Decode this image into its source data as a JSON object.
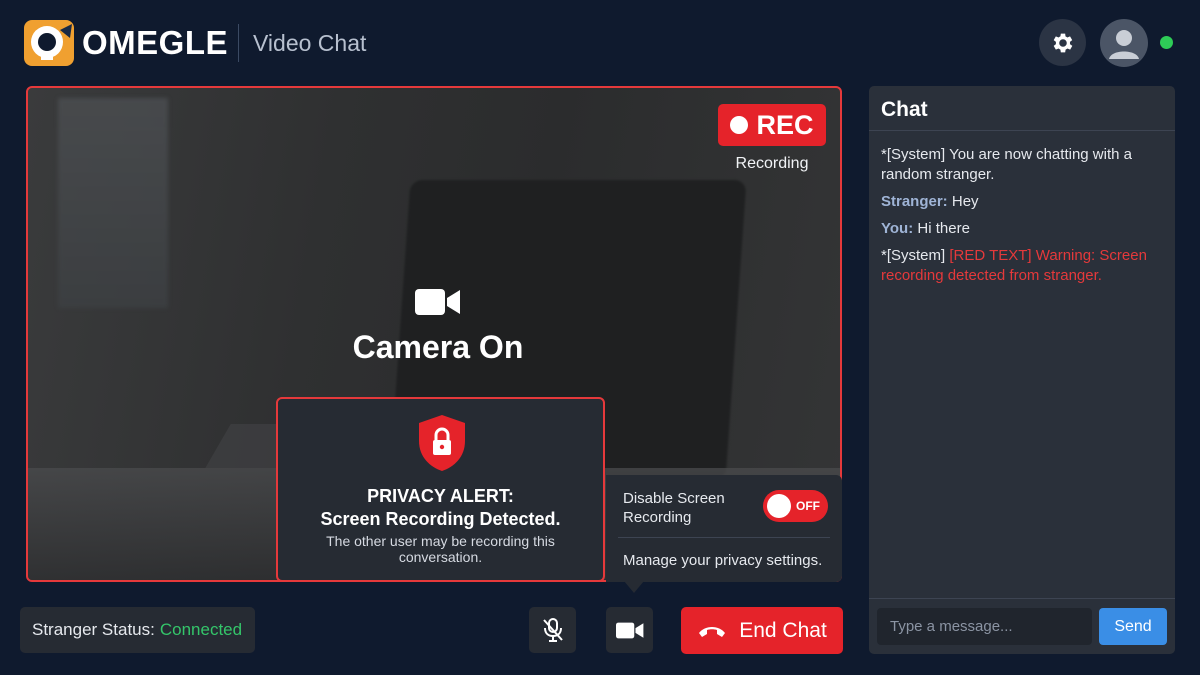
{
  "header": {
    "brand": "OMEGLE",
    "subtitle": "Video Chat",
    "icons": {
      "settings": "gear-icon",
      "avatar": "user-avatar-icon",
      "online": "online-status-dot"
    }
  },
  "video": {
    "rec_badge": "REC",
    "rec_caption": "Recording",
    "camera_label": "Camera On",
    "camera_icon": "video-camera-icon"
  },
  "alert": {
    "icon": "shield-lock-icon",
    "title_line1": "PRIVACY ALERT:",
    "title_line2": "Screen Recording Detected.",
    "body": "The other user may be recording this conversation."
  },
  "recording_settings": {
    "label": "Disable Screen Recording",
    "toggle_text": "OFF",
    "toggle_on": false,
    "manage_link": "Manage your privacy settings."
  },
  "status": {
    "label": "Stranger Status:",
    "value": "Connected"
  },
  "controls": {
    "mic_icon": "mic-off-icon",
    "video_icon": "video-camera-icon",
    "end_icon": "phone-hangup-icon",
    "end_label": "End Chat"
  },
  "chat": {
    "title": "Chat",
    "messages": [
      {
        "text": "*[System] You are now chatting with a random stranger."
      },
      {
        "sender": "Stranger:",
        "text": "Hey"
      },
      {
        "sender": "You:",
        "text": "Hi there"
      },
      {
        "prefix": "*[System]",
        "text": "[RED TEXT] Warning: Screen recording detected from stranger."
      }
    ],
    "input_placeholder": "Type a message...",
    "send_label": "Send"
  },
  "colors": {
    "background": "#0f1a2e",
    "accent_red": "#e5232a",
    "status_green": "#34c56a",
    "send_blue": "#3a8ee6",
    "logo_orange": "#f0a030"
  }
}
